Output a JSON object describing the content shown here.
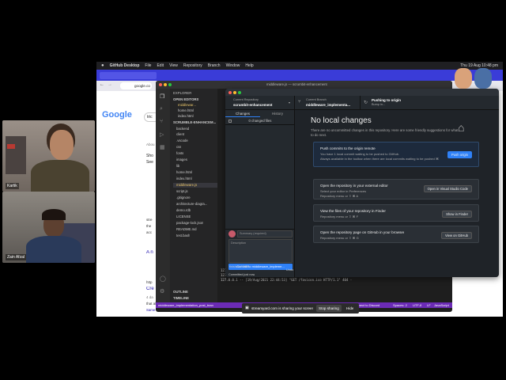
{
  "participants": [
    {
      "name": "Kartik"
    },
    {
      "name": "Zain Afzal"
    }
  ],
  "menubar": {
    "app": "GitHub Desktop",
    "items": [
      "File",
      "Edit",
      "View",
      "Repository",
      "Branch",
      "Window",
      "Help"
    ],
    "clock": "Thu 19 Aug 10:48 pm"
  },
  "browser": {
    "address": "google.co",
    "logo": "Google",
    "search_text": "tric",
    "snippets": [
      "Sho",
      "See",
      "Abou",
      "stre",
      "the",
      "acc",
      "A n",
      "http",
      "Cre",
      "4 da",
      "that allow",
      "Same-origin policy · Access-Control-Max-Age · Shape"
    ]
  },
  "vscode": {
    "title": "middleware.js — scrumbit-enhancement",
    "explorer_label": "EXPLORER",
    "open_editors_label": "OPEN EDITORS",
    "open_editors": [
      "middlewar...",
      "home.html",
      "index.html"
    ],
    "project_label": "SCRUMBLE-ENHANCEM...",
    "files": [
      "backend",
      "client",
      ".vscode",
      "css",
      "fonts",
      "images",
      "lib",
      "home.html",
      "index.html",
      "middleware.js",
      "script.js",
      ".gitignore",
      "architecture-diagra...",
      "demo.rdb",
      "LICENSE",
      "package-lock.json",
      "README.md",
      "test.bash"
    ],
    "outline_label": "OUTLINE",
    "timeline_label": "TIMELINE",
    "terminal_lines": [
      "127.0.0.1 -- [19/Aug/2021 22:44:53] \"GET /images/stickers/sticker-rubric.png HTTP/1.1\" 304 -",
      "127.0.0.1 -- [19/Aug/2021 22:44:53] code 404, message File not found",
      "127.0.0.1 -- [19/Aug/2021 22:44:53] \"GET /favicon.ico HTTP/1.1\" 404 -"
    ],
    "status_left": "middleware_implementation_post_brand*",
    "status_items": [
      "Live Share",
      "Connecting to",
      "Live Share",
      "Reconnect to Discord"
    ],
    "status_right": [
      "Spaces: 2",
      "UTF-8",
      "LF",
      "JavaScript"
    ]
  },
  "github": {
    "current_repo_label": "Current Repository",
    "current_repo": "scrumbit-enhancement",
    "current_branch_label": "Current Branch",
    "current_branch": "middleware_implementa...",
    "push_label": "Pushing to origin",
    "push_sub": "Bump in...",
    "tabs": [
      "Changes",
      "History"
    ],
    "changed_files": "0 changed files",
    "summary_placeholder": "Summary (required)",
    "description_placeholder": "Description",
    "commit_button": "Commit to middleware_impleme...",
    "committed_text": "Committed just now",
    "committed_sub": "finished CORS",
    "undo_label": "Undo",
    "heading": "No local changes",
    "subheading": "There are no uncommitted changes in this repository. Here are some friendly suggestions for what to do next.",
    "cards": [
      {
        "title": "Push commits to the origin remote",
        "desc": "You have 1 local commit waiting to be pushed to GitHub.",
        "desc2": "Always available in the toolbar when there are local commits waiting to be pushed  ⌘ P",
        "button": "Push origin"
      },
      {
        "title": "Open the repository in your external editor",
        "desc": "Select your editor in Preferences",
        "desc2": "Repository menu or ⇧ ⌘ A",
        "button": "Open in Visual Studio Code"
      },
      {
        "title": "View the files of your repository in Finder",
        "desc": "Repository menu or ⇧ ⌘ F",
        "desc2": "",
        "button": "Show in Finder"
      },
      {
        "title": "Open the repository page on GitHub in your browser",
        "desc": "Repository menu or ⇧ ⌘ G",
        "desc2": "",
        "button": "View on GitHub"
      }
    ]
  },
  "share_banner": {
    "text": "streamyard.com is sharing your screen.",
    "stop": "Stop sharing",
    "hide": "Hide"
  },
  "colors": {
    "accent_blue": "#2f81f7",
    "status_purple": "#6b2bb5",
    "chrome_tab": "#3a3cd8"
  }
}
